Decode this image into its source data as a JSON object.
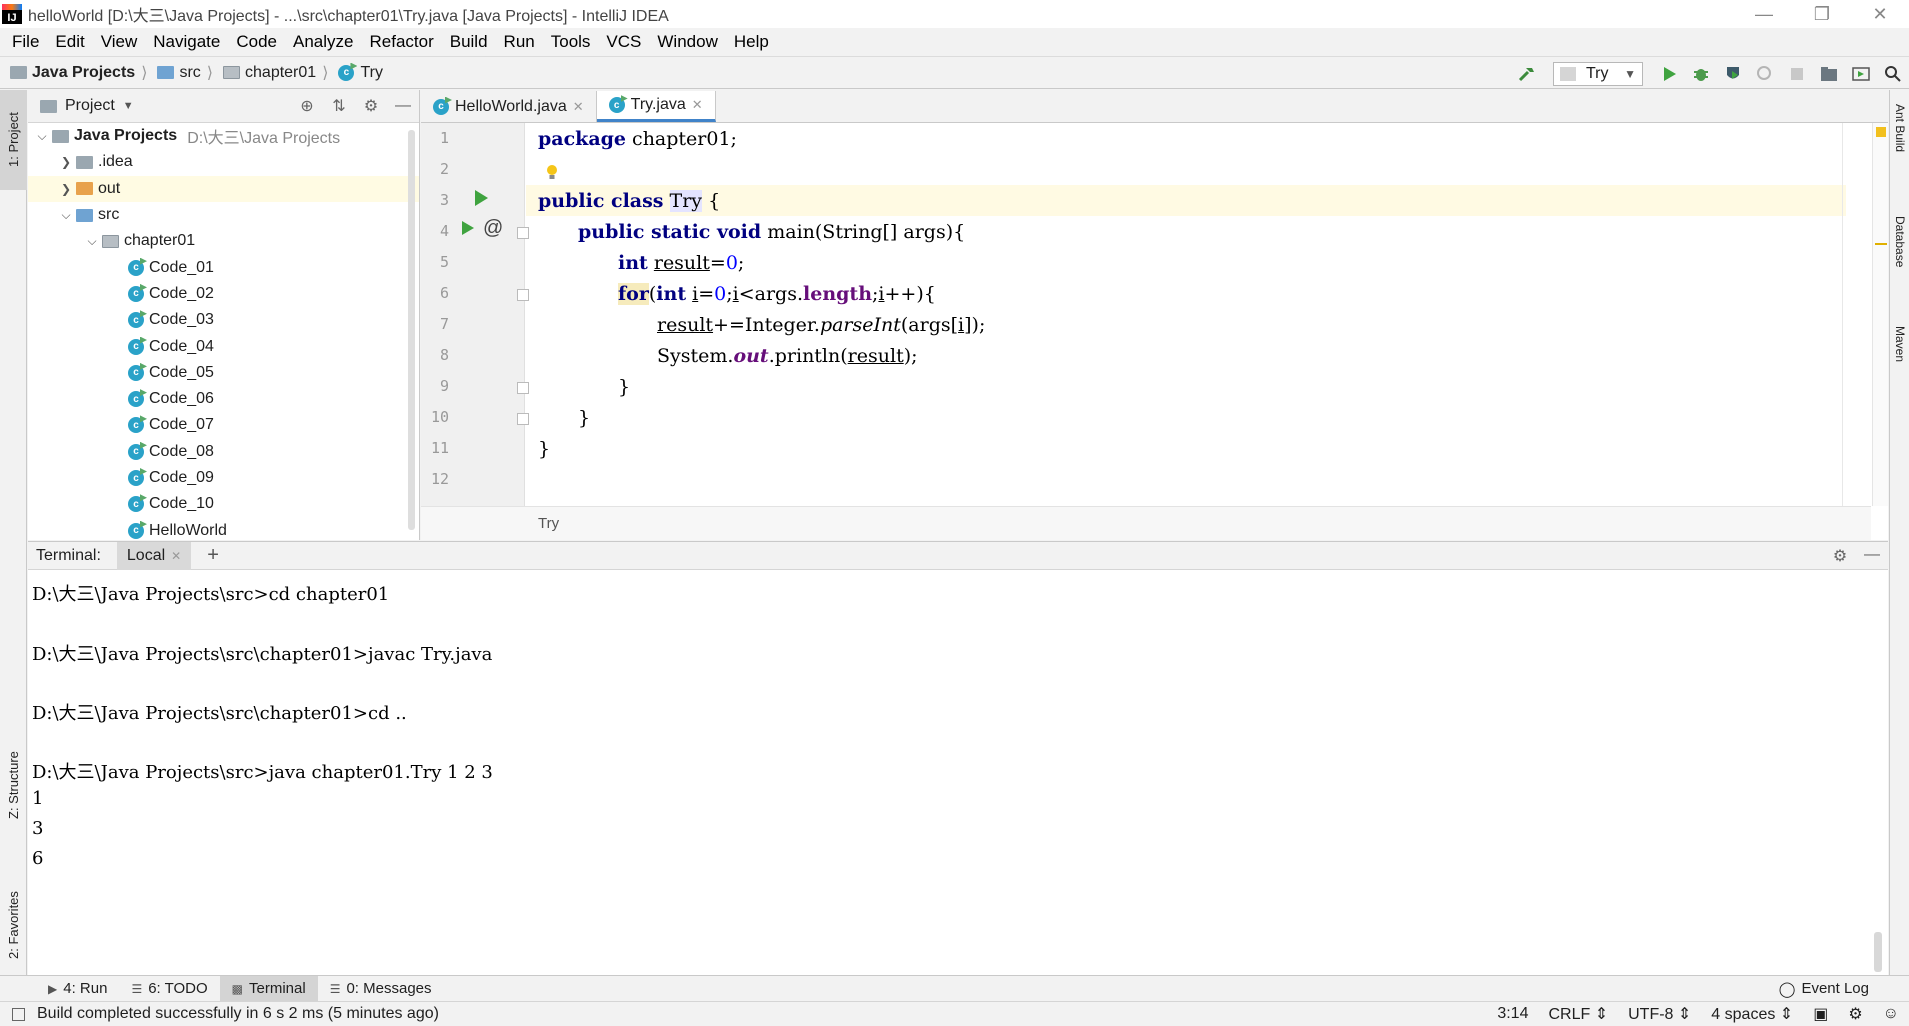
{
  "window": {
    "title": "helloWorld [D:\\大三\\Java Projects] - ...\\src\\chapter01\\Try.java [Java Projects] - IntelliJ IDEA",
    "controls": [
      "minimize",
      "maximize",
      "close"
    ]
  },
  "menu": [
    "File",
    "Edit",
    "View",
    "Navigate",
    "Code",
    "Analyze",
    "Refactor",
    "Build",
    "Run",
    "Tools",
    "VCS",
    "Window",
    "Help"
  ],
  "navbar": {
    "crumbs": [
      "Java Projects",
      "src",
      "chapter01",
      "Try"
    ],
    "run_config": "Try"
  },
  "left_tabs": {
    "project": "1: Project",
    "structure": "Z: Structure",
    "favorites": "2: Favorites"
  },
  "right_tabs": [
    "Ant Build",
    "Database",
    "Maven"
  ],
  "project_panel": {
    "title": "Project",
    "tree": [
      {
        "label": "Java Projects",
        "path": "D:\\大三\\Java Projects",
        "icon": "folder-icon",
        "expanded": true
      },
      {
        "label": ".idea",
        "icon": "folder-icon"
      },
      {
        "label": "out",
        "icon": "folder-icon"
      },
      {
        "label": "src",
        "icon": "folder-icon",
        "expanded": true
      },
      {
        "label": "chapter01",
        "icon": "package-icon",
        "expanded": true
      },
      {
        "label": "Code_01",
        "icon": "class-icon"
      },
      {
        "label": "Code_02",
        "icon": "class-icon"
      },
      {
        "label": "Code_03",
        "icon": "class-icon"
      },
      {
        "label": "Code_04",
        "icon": "class-icon"
      },
      {
        "label": "Code_05",
        "icon": "class-icon"
      },
      {
        "label": "Code_06",
        "icon": "class-icon"
      },
      {
        "label": "Code_07",
        "icon": "class-icon"
      },
      {
        "label": "Code_08",
        "icon": "class-icon"
      },
      {
        "label": "Code_09",
        "icon": "class-icon"
      },
      {
        "label": "Code_10",
        "icon": "class-icon"
      },
      {
        "label": "HelloWorld",
        "icon": "class-icon"
      }
    ]
  },
  "editor": {
    "tabs": [
      {
        "label": "HelloWorld.java",
        "active": false
      },
      {
        "label": "Try.java",
        "active": true
      }
    ],
    "line_numbers": [
      "1",
      "2",
      "3",
      "4",
      "5",
      "6",
      "7",
      "8",
      "9",
      "10",
      "11",
      "12"
    ],
    "code": {
      "l1_kw": "package",
      "l1_rest": " chapter01;",
      "l3_kw": "public class",
      "l3_name": "Try",
      "l3_rest": " {",
      "l4_kw": "public static void",
      "l4_rest": " main(String[] args){",
      "l5_kw": "int",
      "l5_var": "result",
      "l5_eq": "=",
      "l5_num": "0",
      "l5_end": ";",
      "l6_for": "for",
      "l6_open": "(",
      "l6_kw": "int",
      "l6_i1": "i",
      "l6_eq": "=",
      "l6_num": "0",
      "l6_semi": ";",
      "l6_i2": "i",
      "l6_lt": "<args.",
      "l6_len": "length",
      "l6_semi2": ";",
      "l6_i3": "i",
      "l6_end": "++){",
      "l7_var": "result",
      "l7_mid": "+=Integer.",
      "l7_method": "parseInt",
      "l7_args": "(args[",
      "l7_i": "i",
      "l7_end": "]);",
      "l8_sys": "System.",
      "l8_out": "out",
      "l8_mid": ".println(",
      "l8_var": "result",
      "l8_end": ");",
      "l9": "}",
      "l10": "}",
      "l11": "}"
    },
    "breadcrumb": "Try"
  },
  "terminal": {
    "label": "Terminal:",
    "tab": "Local",
    "lines": [
      "D:\\大三\\Java Projects\\src>cd chapter01",
      "D:\\大三\\Java Projects\\src\\chapter01>javac Try.java",
      "D:\\大三\\Java Projects\\src\\chapter01>cd ..",
      "D:\\大三\\Java Projects\\src>java chapter01.Try 1 2 3",
      "1",
      "3",
      "6"
    ]
  },
  "toolwindows": [
    {
      "label": "4: Run",
      "icon": "play-icon"
    },
    {
      "label": "6: TODO",
      "icon": "list-icon"
    },
    {
      "label": "Terminal",
      "icon": "terminal-icon",
      "active": true
    },
    {
      "label": "0: Messages",
      "icon": "messages-icon"
    }
  ],
  "event_log": "Event Log",
  "status": {
    "message": "Build completed successfully in 6 s 2 ms (5 minutes ago)",
    "position": "3:14",
    "line_sep": "CRLF ⇕",
    "encoding": "UTF-8 ⇕",
    "indent": "4 spaces ⇕"
  }
}
